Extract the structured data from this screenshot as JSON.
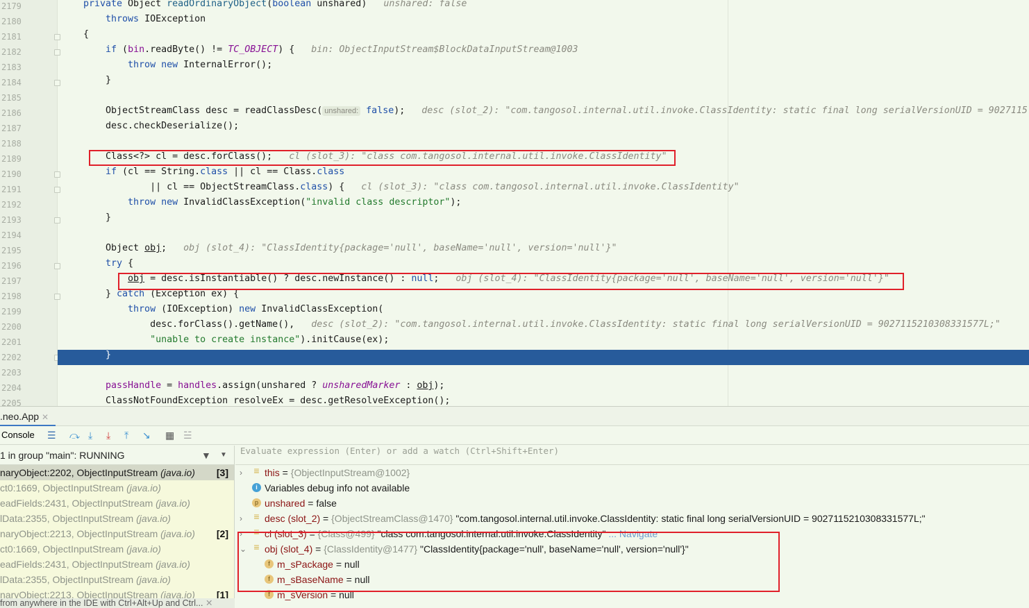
{
  "editor": {
    "lines": [
      {
        "n": "2179",
        "fold": false,
        "t": [
          [
            "private ",
            "kw"
          ],
          [
            "Object ",
            ""
          ],
          [
            "readOrdinaryObject",
            "fn"
          ],
          [
            "(",
            ""
          ],
          [
            "boolean",
            "kw"
          ],
          [
            " unshared)",
            ""
          ],
          [
            "   unshared: false",
            "hint"
          ]
        ]
      },
      {
        "n": "2180",
        "t": [
          [
            "    throws ",
            "kw"
          ],
          [
            "IOException",
            ""
          ]
        ]
      },
      {
        "n": "2181",
        "fold": true,
        "t": [
          [
            "{",
            ""
          ]
        ]
      },
      {
        "n": "2182",
        "fold": true,
        "t": [
          [
            "    if ",
            "kw"
          ],
          [
            "(",
            ""
          ],
          [
            "bin",
            "pu"
          ],
          [
            ".readByte() != ",
            ""
          ],
          [
            "TC_OBJECT",
            "pi"
          ],
          [
            ") {",
            ""
          ],
          [
            "   bin: ObjectInputStream$BlockDataInputStream@1003",
            "hint"
          ]
        ]
      },
      {
        "n": "2183",
        "t": [
          [
            "        throw new ",
            "kw"
          ],
          [
            "InternalError();",
            ""
          ]
        ]
      },
      {
        "n": "2184",
        "fold": true,
        "t": [
          [
            "    }",
            ""
          ]
        ]
      },
      {
        "n": "2185",
        "t": []
      },
      {
        "n": "2186",
        "t": [
          [
            "    ObjectStreamClass desc = readClassDesc(",
            ""
          ],
          [
            "unshared:",
            "ph"
          ],
          [
            " false",
            "kw"
          ],
          [
            ");",
            ""
          ],
          [
            "   desc (slot_2): \"com.tangosol.internal.util.invoke.ClassIdentity: static final long serialVersionUID = 9027115",
            "hint"
          ]
        ]
      },
      {
        "n": "2187",
        "t": [
          [
            "    desc.checkDeserialize();",
            ""
          ]
        ]
      },
      {
        "n": "2188",
        "t": []
      },
      {
        "n": "2189",
        "t": [
          [
            "    Class<?> cl = desc.forClass();",
            ""
          ],
          [
            "   cl (slot_3): \"class com.tangosol.internal.util.invoke.ClassIdentity\"",
            "hint"
          ]
        ]
      },
      {
        "n": "2190",
        "fold": true,
        "t": [
          [
            "    if ",
            "kw"
          ],
          [
            "(cl == String.",
            ""
          ],
          [
            "class",
            "kw"
          ],
          [
            " || cl == Class.",
            ""
          ],
          [
            "class",
            "kw"
          ]
        ]
      },
      {
        "n": "2191",
        "fold": true,
        "t": [
          [
            "            || cl == ObjectStreamClass.",
            ""
          ],
          [
            "class",
            "kw"
          ],
          [
            ") {",
            ""
          ],
          [
            "   cl (slot_3): \"class com.tangosol.internal.util.invoke.ClassIdentity\"",
            "hint"
          ]
        ]
      },
      {
        "n": "2192",
        "t": [
          [
            "        throw new ",
            "kw"
          ],
          [
            "InvalidClassException(",
            ""
          ],
          [
            "\"invalid class descriptor\"",
            "st"
          ],
          [
            ");",
            ""
          ]
        ]
      },
      {
        "n": "2193",
        "fold": true,
        "t": [
          [
            "    }",
            ""
          ]
        ]
      },
      {
        "n": "2194",
        "t": []
      },
      {
        "n": "2195",
        "t": [
          [
            "    Object ",
            ""
          ],
          [
            "obj",
            "ul"
          ],
          [
            ";",
            ""
          ],
          [
            "   obj (slot_4): \"ClassIdentity{package='null', baseName='null', version='null'}\"",
            "hint"
          ]
        ]
      },
      {
        "n": "2196",
        "fold": true,
        "t": [
          [
            "    try ",
            "kw"
          ],
          [
            "{",
            ""
          ]
        ]
      },
      {
        "n": "2197",
        "t": [
          [
            "        ",
            ""
          ],
          [
            "obj",
            "ul"
          ],
          [
            " = desc.isInstantiable() ? desc.newInstance() : ",
            ""
          ],
          [
            "null",
            "kw"
          ],
          [
            ";",
            ""
          ],
          [
            "   obj (slot_4): \"ClassIdentity{package='null', baseName='null', version='null'}\"",
            "hint"
          ]
        ]
      },
      {
        "n": "2198",
        "fold": true,
        "t": [
          [
            "    } ",
            ""
          ],
          [
            "catch ",
            "kw"
          ],
          [
            "(Exception ex) {",
            ""
          ]
        ]
      },
      {
        "n": "2199",
        "t": [
          [
            "        throw ",
            "kw"
          ],
          [
            "(IOException) ",
            ""
          ],
          [
            "new ",
            "kw"
          ],
          [
            "InvalidClassException(",
            ""
          ]
        ]
      },
      {
        "n": "2200",
        "t": [
          [
            "            desc.forClass().getName(),",
            ""
          ],
          [
            "   desc (slot_2): \"com.tangosol.internal.util.invoke.ClassIdentity: static final long serialVersionUID = 9027115210308331577L;\"",
            "hint"
          ]
        ]
      },
      {
        "n": "2201",
        "t": [
          [
            "            ",
            ""
          ],
          [
            "\"unable to create instance\"",
            "st"
          ],
          [
            ").initCause(ex);",
            ""
          ]
        ]
      },
      {
        "n": "2202",
        "fold": true,
        "t": [
          [
            "    }",
            ""
          ]
        ]
      },
      {
        "n": "2203",
        "t": []
      },
      {
        "n": "2204",
        "t": [
          [
            "    ",
            ""
          ],
          [
            "passHandle",
            "pu"
          ],
          [
            " = ",
            ""
          ],
          [
            "handles",
            "pu"
          ],
          [
            ".assign(unshared ? ",
            ""
          ],
          [
            "unsharedMarker",
            "pi"
          ],
          [
            " : ",
            ""
          ],
          [
            "obj",
            "ul"
          ],
          [
            ");",
            ""
          ]
        ]
      },
      {
        "n": "2205",
        "t": [
          [
            "    ClassNotFoundException resolveEx = desc.getResolveException();",
            ""
          ]
        ]
      }
    ]
  },
  "debug": {
    "tab_label": ".neo.App",
    "console_label": "Console",
    "thread_label": "1 in group \"main\": RUNNING",
    "frames": [
      {
        "m": "naryObject:2202, ObjectInputStream ",
        "p": "(java.io)",
        "b": "[3]"
      },
      {
        "m": "ct0:1669, ObjectInputStream ",
        "p": "(java.io)",
        "b": ""
      },
      {
        "m": "eadFields:2431, ObjectInputStream ",
        "p": "(java.io)",
        "b": ""
      },
      {
        "m": "lData:2355, ObjectInputStream ",
        "p": "(java.io)",
        "b": ""
      },
      {
        "m": "naryObject:2213, ObjectInputStream ",
        "p": "(java.io)",
        "b": "[2]"
      },
      {
        "m": "ct0:1669, ObjectInputStream ",
        "p": "(java.io)",
        "b": ""
      },
      {
        "m": "eadFields:2431, ObjectInputStream ",
        "p": "(java.io)",
        "b": ""
      },
      {
        "m": "lData:2355, ObjectInputStream ",
        "p": "(java.io)",
        "b": ""
      },
      {
        "m": "naryObject:2213, ObjectInputStream ",
        "p": "(java.io)",
        "b": "[1]"
      }
    ],
    "status_hint": "from anywhere in the IDE with Ctrl+Alt+Up and Ctrl...",
    "eval_placeholder": "Evaluate expression (Enter) or add a watch (Ctrl+Shift+Enter)",
    "variables": [
      {
        "icon": "lines",
        "arrow": "›",
        "name": "this",
        "eq": " = ",
        "type": "{ObjectInputStream@1002}",
        "val": "",
        "nav": ""
      },
      {
        "icon": "info",
        "arrow": "",
        "name": "",
        "eq": "",
        "type": "",
        "val": "Variables debug info not available",
        "nav": ""
      },
      {
        "icon": "p",
        "arrow": "",
        "name": "unshared",
        "eq": " = ",
        "type": "",
        "val": "false",
        "nav": ""
      },
      {
        "icon": "lines",
        "arrow": "›",
        "name": "desc (slot_2)",
        "eq": " = ",
        "type": "{ObjectStreamClass@1470} ",
        "val": "\"com.tangosol.internal.util.invoke.ClassIdentity: static final long serialVersionUID = 9027115210308331577L;\"",
        "nav": ""
      },
      {
        "icon": "lines",
        "arrow": "›",
        "name": "cl (slot_3)",
        "eq": " = ",
        "type": "{Class@499} ",
        "val": "\"class com.tangosol.internal.util.invoke.ClassIdentity\"",
        "nav": " ... Navigate"
      },
      {
        "icon": "lines",
        "arrow": "⌄",
        "name": "obj (slot_4)",
        "eq": " = ",
        "type": "{ClassIdentity@1477} ",
        "val": "\"ClassIdentity{package='null', baseName='null', version='null'}\"",
        "nav": ""
      },
      {
        "icon": "f",
        "arrow": "",
        "name": "m_sPackage",
        "eq": " = ",
        "type": "",
        "val": "null",
        "nav": "",
        "child": true
      },
      {
        "icon": "f",
        "arrow": "",
        "name": "m_sBaseName",
        "eq": " = ",
        "type": "",
        "val": "null",
        "nav": "",
        "child": true
      },
      {
        "icon": "f",
        "arrow": "",
        "name": "m_sVersion",
        "eq": " = ",
        "type": "",
        "val": "null",
        "nav": "",
        "child": true
      }
    ]
  },
  "colors": {
    "highlight": "#275b9b",
    "annotation": "#e0202a",
    "editor_bg": "#f2f8ec"
  }
}
